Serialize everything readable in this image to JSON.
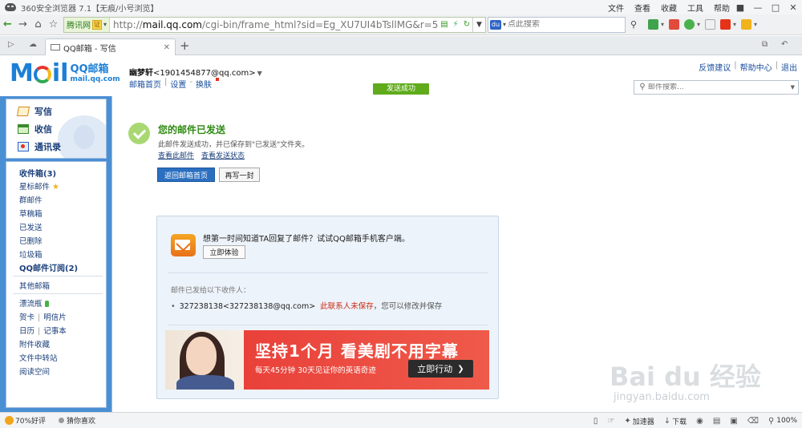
{
  "browser": {
    "title": "360安全浏览器 7.1【无痕/小号浏览】",
    "menu": [
      "文件",
      "查看",
      "收藏",
      "工具",
      "帮助"
    ],
    "url_tag": "腾讯网",
    "url_prefix": "http://",
    "url_host": "mail.qq.com",
    "url_rest": "/cgi-bin/frame_html?sid=Eg_XU7UI4bTsllMG&r=544f0f171.",
    "search_placeholder": "点此搜索",
    "tab_title": "QQ邮箱 - 写信",
    "zoom": "100%"
  },
  "header": {
    "logo_cn": "QQ邮箱",
    "logo_domain": "mail.qq.com",
    "user_name": "幽梦轩",
    "user_email": "<1901454877@qq.com>",
    "links": [
      "邮箱首页",
      "设置",
      "换肤"
    ],
    "toplinks": [
      "反馈建议",
      "帮助中心",
      "退出"
    ],
    "sent_badge": "发送成功",
    "search_placeholder": "邮件搜索..."
  },
  "sidebar": {
    "quick": [
      "写信",
      "收信",
      "通讯录"
    ],
    "folders": {
      "inbox": "收件箱(3)",
      "starred": "星标邮件",
      "group": "群邮件",
      "drafts": "草稿箱",
      "sent": "已发送",
      "deleted": "已删除",
      "spam": "垃圾箱",
      "subscriptions": "QQ邮件订阅(2)",
      "other": "其他邮箱",
      "drift": "漂流瓶",
      "card": "贺卡",
      "postcard": "明信片",
      "calendar": "日历",
      "notes": "记事本",
      "attachments": "附件收藏",
      "transfer": "文件中转站",
      "reading": "阅读空间"
    }
  },
  "main": {
    "title": "您的邮件已发送",
    "desc": "此邮件发送成功，并已保存到\"已发送\"文件夹。",
    "link_view": "查看此邮件",
    "link_status": "查看发送状态",
    "btn_back": "返回邮箱首页",
    "btn_again": "再写一封",
    "promo_text": "想第一时间知道TA回复了邮件？试试QQ邮箱手机客户端。",
    "promo_btn": "立即体验",
    "recip_label": "邮件已发给以下收件人：",
    "recip_addr": "327238138<327238138@qq.com>",
    "recip_warn": "此联系人未保存",
    "recip_fix": "，您可以修改并保存",
    "ad_big": "坚持1个月 看美剧不用字幕",
    "ad_small": "每天45分钟 30天见证你的英语奇迹",
    "ad_btn": "立即行动"
  },
  "status": {
    "rating": "70%好评",
    "guess": "猜你喜欢",
    "speed": "加速器",
    "download": "下载"
  },
  "watermark": {
    "main": "Bai du 经验",
    "sub": "jingyan.baidu.com"
  },
  "colors": {
    "accent_blue": "#4a8fd4",
    "success_green": "#5fab1b",
    "warn_red": "#cc2a14"
  }
}
